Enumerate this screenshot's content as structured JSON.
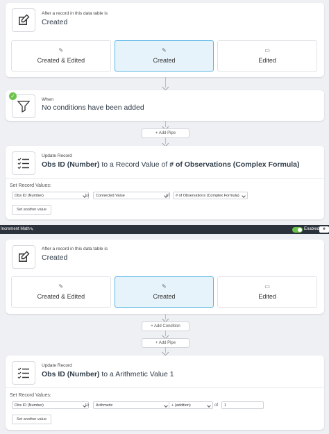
{
  "block1": {
    "trigger_caption": "After a record in this data table is",
    "trigger_value": "Created",
    "options": [
      {
        "label": "Created & Edited",
        "icon": "✎"
      },
      {
        "label": "Created",
        "icon": "✎"
      },
      {
        "label": "Edited",
        "icon": "▭"
      }
    ],
    "when_caption": "When",
    "when_value": "No conditions have been added",
    "add_pipe": "+ Add Pipe",
    "action_caption": "Update Record",
    "action_title_bold1": "Obs ID (Number)",
    "action_title_mid": " to a Record Value of ",
    "action_title_bold2": "# of Observations (Complex Formula)",
    "set_label": "Set Record Values:",
    "field1": "Obs ID (Number)",
    "to": "to",
    "field2": "Connected Value",
    "of": "of",
    "field3": "# of Observations (Complex Formula)",
    "set_another": "Set another value"
  },
  "topbar": {
    "title": "Increment Math",
    "enabled": "Enabled"
  },
  "block2": {
    "trigger_caption": "After a record in this data table is",
    "trigger_value": "Created",
    "options": [
      {
        "label": "Created & Edited",
        "icon": "✎"
      },
      {
        "label": "Created",
        "icon": "✎"
      },
      {
        "label": "Edited",
        "icon": "▭"
      }
    ],
    "add_condition": "+ Add Condition",
    "add_pipe": "+ Add Pipe",
    "action_caption": "Update Record",
    "action_title_bold1": "Obs ID (Number)",
    "action_title_mid": " to a Arithmetic Value 1",
    "set_label": "Set Record Values:",
    "field1": "Obs ID (Number)",
    "to": "to",
    "field2": "Arithmetic",
    "field3": "+ (addition)",
    "of": "of",
    "value": "1",
    "set_another": "Set another value"
  }
}
